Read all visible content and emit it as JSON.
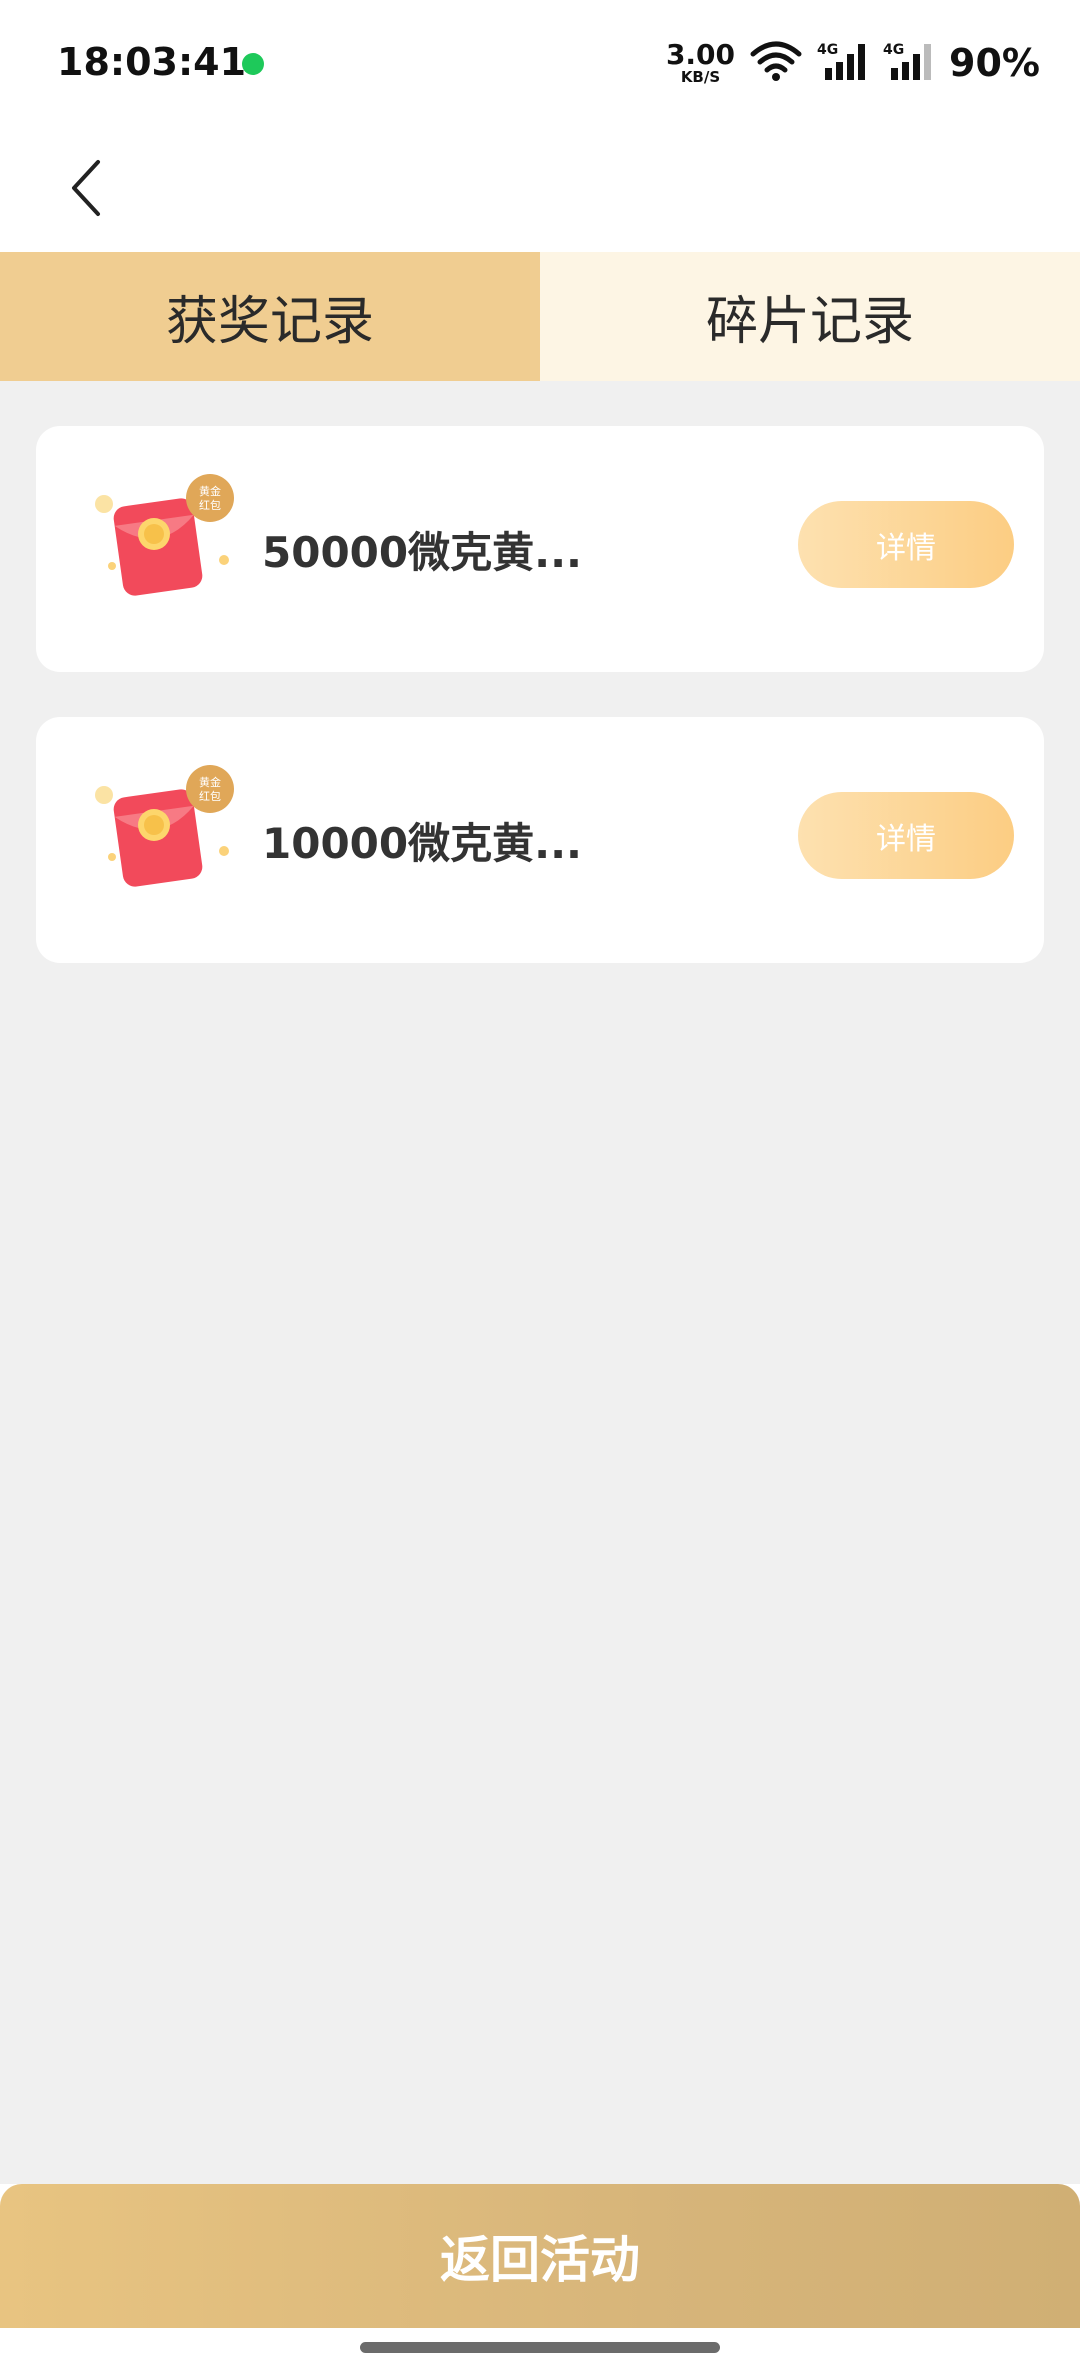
{
  "status_bar": {
    "time": "18:03:41",
    "net_speed_value": "3.00",
    "net_speed_unit": "KB/S",
    "battery": "90%",
    "icons": [
      "wechat-notification-icon",
      "wifi-icon",
      "signal-4g-icon",
      "signal-4g-icon",
      "battery-icon"
    ]
  },
  "header": {
    "back_icon": "chevron-left-icon"
  },
  "tabs": [
    {
      "label": "获奖记录",
      "active": true
    },
    {
      "label": "碎片记录",
      "active": false
    }
  ],
  "records": [
    {
      "icon": "gold-red-envelope-icon",
      "badge": "黄金红包",
      "title": "50000微克黄...",
      "button": "详情"
    },
    {
      "icon": "gold-red-envelope-icon",
      "badge": "黄金红包",
      "title": "10000微克黄...",
      "button": "详情"
    }
  ],
  "bottom": {
    "return_label": "返回活动"
  },
  "colors": {
    "tab_active": "#f0cd91",
    "tab_inactive": "#fdf5e4",
    "button_gradient_start": "#fde1b0",
    "button_gradient_end": "#fccd83",
    "return_bar": "#ddbb7c",
    "envelope_red": "#f24a5b",
    "page_bg": "#f0f0f0"
  }
}
